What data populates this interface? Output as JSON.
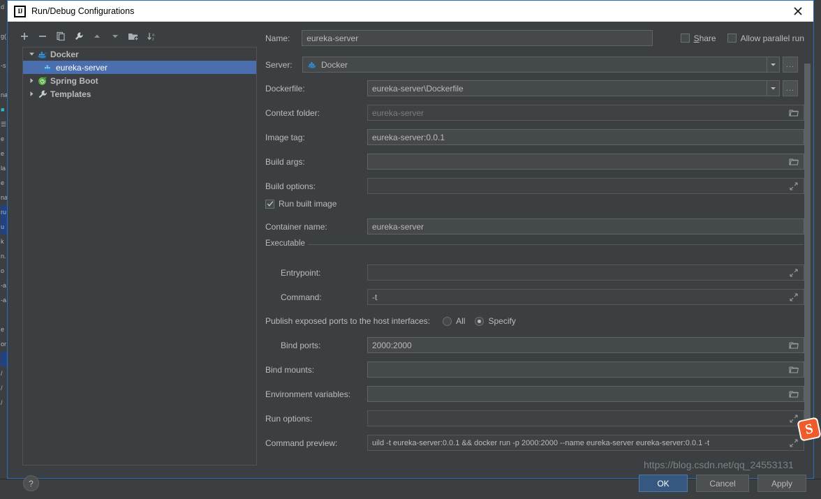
{
  "window": {
    "title": "Run/Debug Configurations",
    "app_icon": "intellij-idea-icon",
    "close_icon": "close-icon"
  },
  "toolbar": {
    "buttons": [
      {
        "name": "add-configuration-button",
        "icon": "plus-icon"
      },
      {
        "name": "remove-configuration-button",
        "icon": "minus-icon"
      },
      {
        "name": "copy-configuration-button",
        "icon": "copy-icon"
      },
      {
        "name": "edit-templates-button",
        "icon": "wrench-icon"
      },
      {
        "name": "move-up-button",
        "icon": "arrow-up-icon"
      },
      {
        "name": "move-down-button",
        "icon": "arrow-down-icon"
      },
      {
        "name": "create-folder-button",
        "icon": "folder-add-icon"
      },
      {
        "name": "sort-configurations-button",
        "icon": "sort-az-icon"
      }
    ]
  },
  "tree": {
    "nodes": [
      {
        "label": "Docker",
        "icon": "docker-icon",
        "expanded": true,
        "selected": false,
        "level": 0
      },
      {
        "label": "eureka-server",
        "icon": "docker-icon",
        "expanded": null,
        "selected": true,
        "level": 1
      },
      {
        "label": "Spring Boot",
        "icon": "spring-boot-icon",
        "expanded": false,
        "selected": false,
        "level": 0
      },
      {
        "label": "Templates",
        "icon": "wrench-icon",
        "expanded": false,
        "selected": false,
        "level": 0
      }
    ]
  },
  "form": {
    "name_label": "Name:",
    "name_value": "eureka-server",
    "share_label": "Share",
    "share_checked": false,
    "allow_parallel_label": "Allow parallel run",
    "allow_parallel_checked": false,
    "server_label": "Server:",
    "server_value": "Docker",
    "browse_label": "...",
    "dockerfile_label": "Dockerfile:",
    "dockerfile_value": "eureka-server\\Dockerfile",
    "context_folder_label": "Context folder:",
    "context_folder_placeholder": "eureka-server",
    "context_folder_value": "",
    "image_tag_label": "Image tag:",
    "image_tag_value": "eureka-server:0.0.1",
    "build_args_label": "Build args:",
    "build_args_value": "",
    "build_options_label": "Build options:",
    "build_options_value": "",
    "run_built_image_label": "Run built image",
    "run_built_image_checked": true,
    "container_name_label": "Container name:",
    "container_name_value": "eureka-server",
    "executable_group_label": "Executable",
    "entrypoint_label": "Entrypoint:",
    "entrypoint_value": "",
    "command_label": "Command:",
    "command_value": "-t",
    "publish_ports_label": "Publish exposed ports to the host interfaces:",
    "publish_all_label": "All",
    "publish_specify_label": "Specify",
    "publish_selected": "Specify",
    "bind_ports_label": "Bind ports:",
    "bind_ports_value": "2000:2000",
    "bind_mounts_label": "Bind mounts:",
    "bind_mounts_value": "",
    "environment_variables_label": "Environment variables:",
    "environment_variables_value": "",
    "run_options_label": "Run options:",
    "run_options_value": "",
    "command_preview_label": "Command preview:",
    "command_preview_value": "uild -t eureka-server:0.0.1 && docker run -p 2000:2000 --name eureka-server eureka-server:0.0.1 -t"
  },
  "buttons": {
    "help_label": "?",
    "ok_label": "OK",
    "cancel_label": "Cancel",
    "apply_label": "Apply"
  },
  "watermark": {
    "url": "https://blog.csdn.net/qq_24553131",
    "logo_letter": "S"
  },
  "ide_background": {
    "left_strip_lines": [
      "d",
      "",
      "g(",
      "",
      "-s",
      "",
      "na",
      "",
      "",
      "",
      "e",
      "",
      "la",
      "e",
      "na",
      "ru",
      "u",
      "k",
      "n.",
      "o",
      "-a",
      "-a",
      "",
      "e",
      "or",
      "",
      "",
      "",
      ""
    ]
  },
  "colors": {
    "accent": "#4b6eaf",
    "primary_button": "#365880",
    "dialog_bg": "#3c3f41",
    "field_bg": "#45494a",
    "border": "#2d6ebd",
    "text": "#bbbbbb"
  }
}
